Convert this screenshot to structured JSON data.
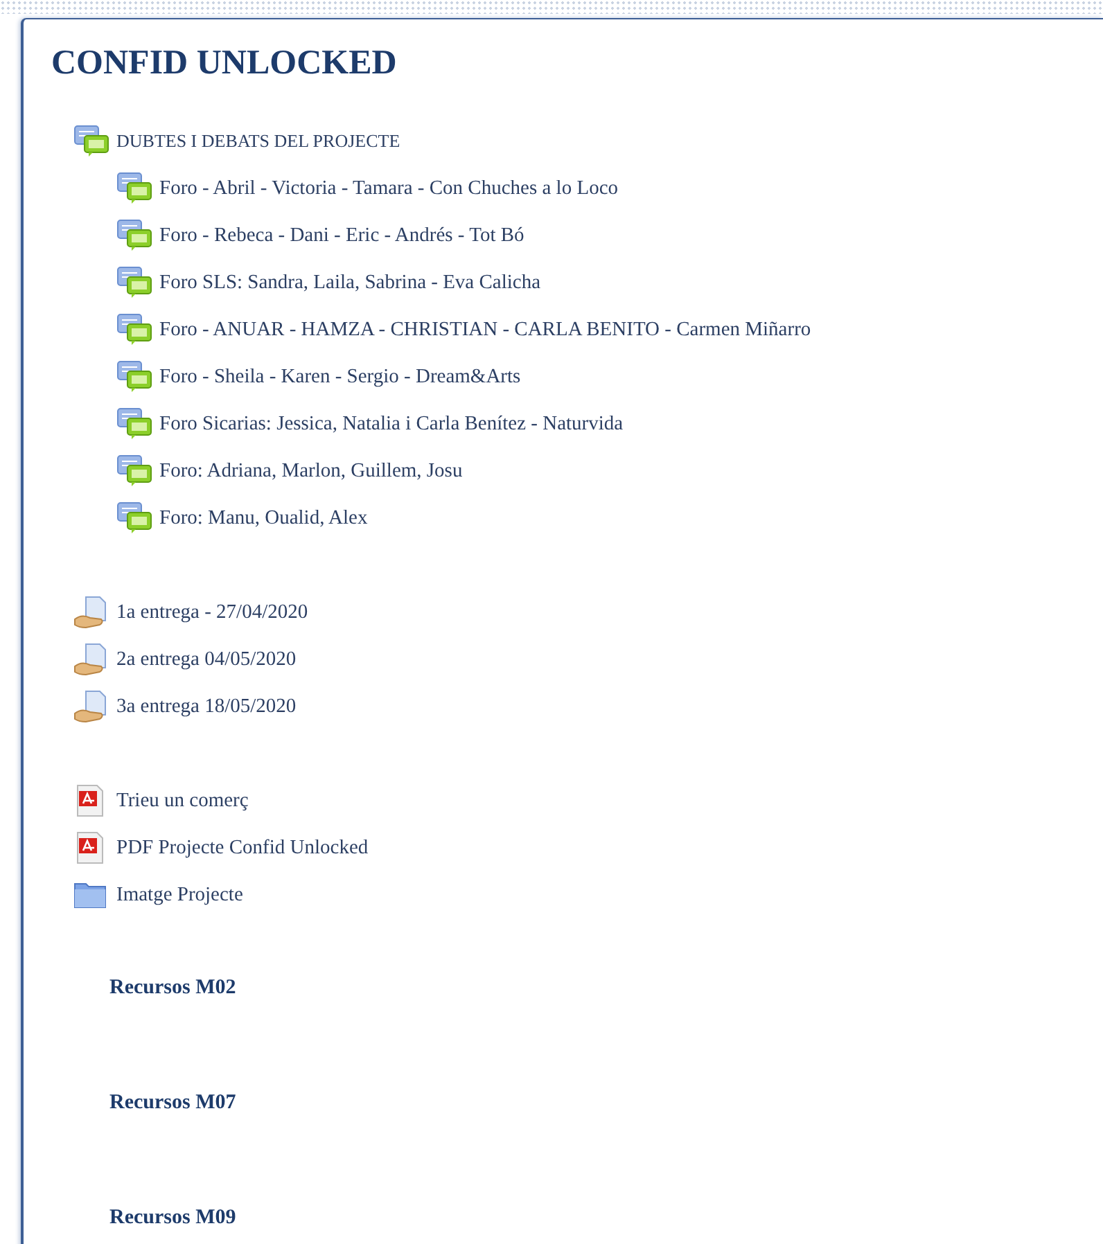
{
  "title": "CONFID UNLOCKED",
  "groups": [
    {
      "kind": "forum",
      "label": "DUBTES I DEBATS DEL PROJECTE",
      "children": [
        {
          "kind": "forum",
          "label": "Foro - Abril - Victoria - Tamara - Con Chuches a lo Loco"
        },
        {
          "kind": "forum",
          "label": "Foro - Rebeca - Dani - Eric - Andrés - Tot Bó"
        },
        {
          "kind": "forum",
          "label": "Foro SLS: Sandra, Laila, Sabrina - Eva Calicha"
        },
        {
          "kind": "forum",
          "label": "Foro - ANUAR - HAMZA - CHRISTIAN - CARLA BENITO - Carmen Miñarro"
        },
        {
          "kind": "forum",
          "label": "Foro - Sheila - Karen - Sergio - Dream&Arts"
        },
        {
          "kind": "forum",
          "label": "Foro Sicarias: Jessica, Natalia i Carla Benítez - Naturvida"
        },
        {
          "kind": "forum",
          "label": "Foro: Adriana, Marlon, Guillem, Josu"
        },
        {
          "kind": "forum",
          "label": "Foro: Manu, Oualid, Alex"
        }
      ]
    }
  ],
  "assignments": [
    {
      "kind": "assignment",
      "label": "1a entrega - 27/04/2020"
    },
    {
      "kind": "assignment",
      "label": "2a entrega 04/05/2020"
    },
    {
      "kind": "assignment",
      "label": "3a entrega 18/05/2020"
    }
  ],
  "resources": [
    {
      "kind": "pdf",
      "label": "Trieu un comerç"
    },
    {
      "kind": "pdf",
      "label": "PDF Projecte Confid Unlocked"
    },
    {
      "kind": "folder",
      "label": "Imatge Projecte"
    }
  ],
  "sections": [
    "Recursos M02",
    "Recursos M07",
    "Recursos M09"
  ]
}
